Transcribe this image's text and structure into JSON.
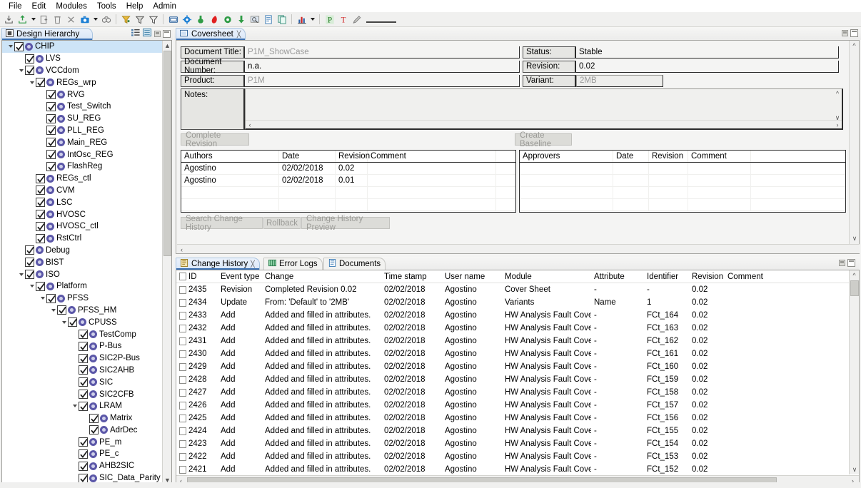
{
  "menubar": {
    "items": [
      "File",
      "Edit",
      "Modules",
      "Tools",
      "Help",
      "Admin"
    ]
  },
  "toolbar": {
    "groups": [
      {
        "icons": [
          "import-icon",
          "export-icon",
          "dropdown-caret",
          "add-document-icon",
          "delete-icon",
          "cut-icon",
          "snapshot-icon",
          "dropdown-caret",
          "compare-icon"
        ]
      },
      {
        "icons": [
          "filter-apply-icon",
          "filter-icon",
          "filter-clear-icon"
        ]
      },
      {
        "icons": [
          "window-icon",
          "settings-gear-icon",
          "tree-green-icon",
          "italic-red-icon",
          "node-green-icon",
          "down-arrow-green-icon",
          "zoom-icon",
          "report-icon",
          "copy-icon"
        ]
      },
      {
        "icons": [
          "chart-icon",
          "dropdown-caret"
        ]
      },
      {
        "icons": [
          "p-letter-icon",
          "t-letter-icon",
          "pencil-icon"
        ]
      }
    ]
  },
  "left_panel": {
    "tab_label": "Design Hierarchy",
    "tab_icon": "view-icon",
    "tools": [
      "collapse-all-icon",
      "link-editor-icon",
      "minimize-icon",
      "maximize-icon"
    ],
    "tree": [
      {
        "label": "CHIP",
        "indent": 0,
        "twisty": true,
        "checked": true,
        "selected": true
      },
      {
        "label": "LVS",
        "indent": 1,
        "twisty": false,
        "checked": true,
        "selected": false
      },
      {
        "label": "VCCdom",
        "indent": 1,
        "twisty": true,
        "checked": true,
        "selected": false
      },
      {
        "label": "REGs_wrp",
        "indent": 2,
        "twisty": true,
        "checked": true,
        "selected": false
      },
      {
        "label": "RVG",
        "indent": 3,
        "twisty": false,
        "checked": true,
        "selected": false
      },
      {
        "label": "Test_Switch",
        "indent": 3,
        "twisty": false,
        "checked": true,
        "selected": false
      },
      {
        "label": "SU_REG",
        "indent": 3,
        "twisty": false,
        "checked": true,
        "selected": false
      },
      {
        "label": "PLL_REG",
        "indent": 3,
        "twisty": false,
        "checked": true,
        "selected": false
      },
      {
        "label": "Main_REG",
        "indent": 3,
        "twisty": false,
        "checked": true,
        "selected": false
      },
      {
        "label": "IntOsc_REG",
        "indent": 3,
        "twisty": false,
        "checked": true,
        "selected": false
      },
      {
        "label": "FlashReg",
        "indent": 3,
        "twisty": false,
        "checked": true,
        "selected": false
      },
      {
        "label": "REGs_ctl",
        "indent": 2,
        "twisty": false,
        "checked": true,
        "selected": false
      },
      {
        "label": "CVM",
        "indent": 2,
        "twisty": false,
        "checked": true,
        "selected": false
      },
      {
        "label": "LSC",
        "indent": 2,
        "twisty": false,
        "checked": true,
        "selected": false
      },
      {
        "label": "HVOSC",
        "indent": 2,
        "twisty": false,
        "checked": true,
        "selected": false
      },
      {
        "label": "HVOSC_ctl",
        "indent": 2,
        "twisty": false,
        "checked": true,
        "selected": false
      },
      {
        "label": "RstCtrl",
        "indent": 2,
        "twisty": false,
        "checked": true,
        "selected": false
      },
      {
        "label": "Debug",
        "indent": 1,
        "twisty": false,
        "checked": true,
        "selected": false
      },
      {
        "label": "BIST",
        "indent": 1,
        "twisty": false,
        "checked": true,
        "selected": false
      },
      {
        "label": "ISO",
        "indent": 1,
        "twisty": true,
        "checked": true,
        "selected": false
      },
      {
        "label": "Platform",
        "indent": 2,
        "twisty": true,
        "checked": true,
        "selected": false
      },
      {
        "label": "PFSS",
        "indent": 3,
        "twisty": true,
        "checked": true,
        "selected": false
      },
      {
        "label": "PFSS_HM",
        "indent": 4,
        "twisty": true,
        "checked": true,
        "selected": false
      },
      {
        "label": "CPUSS",
        "indent": 5,
        "twisty": true,
        "checked": true,
        "selected": false
      },
      {
        "label": "TestComp",
        "indent": 6,
        "twisty": false,
        "checked": true,
        "selected": false
      },
      {
        "label": "P-Bus",
        "indent": 6,
        "twisty": false,
        "checked": true,
        "selected": false
      },
      {
        "label": "SIC2P-Bus",
        "indent": 6,
        "twisty": false,
        "checked": true,
        "selected": false
      },
      {
        "label": "SIC2AHB",
        "indent": 6,
        "twisty": false,
        "checked": true,
        "selected": false
      },
      {
        "label": "SIC",
        "indent": 6,
        "twisty": false,
        "checked": true,
        "selected": false
      },
      {
        "label": "SIC2CFB",
        "indent": 6,
        "twisty": false,
        "checked": true,
        "selected": false
      },
      {
        "label": "LRAM",
        "indent": 6,
        "twisty": true,
        "checked": true,
        "selected": false
      },
      {
        "label": "Matrix",
        "indent": 7,
        "twisty": false,
        "checked": true,
        "selected": false
      },
      {
        "label": "AdrDec",
        "indent": 7,
        "twisty": false,
        "checked": true,
        "selected": false
      },
      {
        "label": "PE_m",
        "indent": 6,
        "twisty": false,
        "checked": true,
        "selected": false
      },
      {
        "label": "PE_c",
        "indent": 6,
        "twisty": false,
        "checked": true,
        "selected": false
      },
      {
        "label": "AHB2SIC",
        "indent": 6,
        "twisty": false,
        "checked": true,
        "selected": false
      },
      {
        "label": "SIC_Data_Parity",
        "indent": 6,
        "twisty": false,
        "checked": true,
        "selected": false
      }
    ]
  },
  "coversheet": {
    "tab_label": "Coversheet",
    "tab_icon": "coversheet-icon",
    "fields_left": [
      {
        "label": "Document Title:",
        "value": "P1M_ShowCase",
        "placeholder": true
      },
      {
        "label": "Document Number:",
        "value": "n.a.",
        "placeholder": false
      },
      {
        "label": "Product:",
        "value": "P1M",
        "placeholder": true
      }
    ],
    "fields_right": [
      {
        "label": "Status:",
        "value": "Stable",
        "placeholder": false
      },
      {
        "label": "Revision:",
        "value": "0.02",
        "placeholder": false
      },
      {
        "label": "Variant:",
        "value": "2MB",
        "placeholder": true
      }
    ],
    "notes_label": "Notes:",
    "notes_value": "",
    "complete_revision_button": "Complete Revision",
    "create_baseline_button": "Create Baseline",
    "authors_table": {
      "columns": [
        "Authors",
        "Date",
        "Revision",
        "Comment"
      ],
      "rows": [
        [
          "Agostino",
          "02/02/2018",
          "0.02",
          ""
        ],
        [
          "Agostino",
          "02/02/2018",
          "0.01",
          ""
        ]
      ]
    },
    "approvers_table": {
      "columns": [
        "Approvers",
        "Date",
        "Revision",
        "Comment"
      ],
      "rows": []
    },
    "bottom_buttons": [
      "Search Change History",
      "Rollback",
      "Change History Preview"
    ]
  },
  "lower_panel": {
    "tabs": [
      {
        "label": "Change History",
        "icon": "change-history-icon",
        "active": true,
        "closable": true
      },
      {
        "label": "Error Logs",
        "icon": "error-logs-icon",
        "active": false,
        "closable": false
      },
      {
        "label": "Documents",
        "icon": "documents-icon",
        "active": false,
        "closable": false
      }
    ],
    "table": {
      "columns": [
        "ID",
        "Event type",
        "Change",
        "Time stamp",
        "User name",
        "Module",
        "Attribute",
        "Identifier",
        "Revision",
        "Comment"
      ],
      "rows": [
        [
          "2435",
          "Revision",
          "Completed Revision 0.02",
          "02/02/2018",
          "Agostino",
          "Cover Sheet",
          "-",
          "-",
          "0.02",
          ""
        ],
        [
          "2434",
          "Update",
          "From: 'Default' to '2MB'",
          "02/02/2018",
          "Agostino",
          "Variants",
          "Name",
          "1",
          "0.02",
          ""
        ],
        [
          "2433",
          "Add",
          "Added and filled in attributes.",
          "02/02/2018",
          "Agostino",
          "HW Analysis Fault Coverage",
          "-",
          "FCt_164",
          "0.02",
          ""
        ],
        [
          "2432",
          "Add",
          "Added and filled in attributes.",
          "02/02/2018",
          "Agostino",
          "HW Analysis Fault Coverage",
          "-",
          "FCt_163",
          "0.02",
          ""
        ],
        [
          "2431",
          "Add",
          "Added and filled in attributes.",
          "02/02/2018",
          "Agostino",
          "HW Analysis Fault Coverage",
          "-",
          "FCt_162",
          "0.02",
          ""
        ],
        [
          "2430",
          "Add",
          "Added and filled in attributes.",
          "02/02/2018",
          "Agostino",
          "HW Analysis Fault Coverage",
          "-",
          "FCt_161",
          "0.02",
          ""
        ],
        [
          "2429",
          "Add",
          "Added and filled in attributes.",
          "02/02/2018",
          "Agostino",
          "HW Analysis Fault Coverage",
          "-",
          "FCt_160",
          "0.02",
          ""
        ],
        [
          "2428",
          "Add",
          "Added and filled in attributes.",
          "02/02/2018",
          "Agostino",
          "HW Analysis Fault Coverage",
          "-",
          "FCt_159",
          "0.02",
          ""
        ],
        [
          "2427",
          "Add",
          "Added and filled in attributes.",
          "02/02/2018",
          "Agostino",
          "HW Analysis Fault Coverage",
          "-",
          "FCt_158",
          "0.02",
          ""
        ],
        [
          "2426",
          "Add",
          "Added and filled in attributes.",
          "02/02/2018",
          "Agostino",
          "HW Analysis Fault Coverage",
          "-",
          "FCt_157",
          "0.02",
          ""
        ],
        [
          "2425",
          "Add",
          "Added and filled in attributes.",
          "02/02/2018",
          "Agostino",
          "HW Analysis Fault Coverage",
          "-",
          "FCt_156",
          "0.02",
          ""
        ],
        [
          "2424",
          "Add",
          "Added and filled in attributes.",
          "02/02/2018",
          "Agostino",
          "HW Analysis Fault Coverage",
          "-",
          "FCt_155",
          "0.02",
          ""
        ],
        [
          "2423",
          "Add",
          "Added and filled in attributes.",
          "02/02/2018",
          "Agostino",
          "HW Analysis Fault Coverage",
          "-",
          "FCt_154",
          "0.02",
          ""
        ],
        [
          "2422",
          "Add",
          "Added and filled in attributes.",
          "02/02/2018",
          "Agostino",
          "HW Analysis Fault Coverage",
          "-",
          "FCt_153",
          "0.02",
          ""
        ],
        [
          "2421",
          "Add",
          "Added and filled in attributes.",
          "02/02/2018",
          "Agostino",
          "HW Analysis Fault Coverage",
          "-",
          "FCt_152",
          "0.02",
          ""
        ]
      ]
    }
  },
  "colors": {
    "accent_blue": "#3b6fb0",
    "tab_fill": "#dbe8f8",
    "selection": "#cde4f7",
    "node_purple": "#5b57a8",
    "toolbar_green": "#2e9b45",
    "toolbar_red": "#d02020"
  }
}
